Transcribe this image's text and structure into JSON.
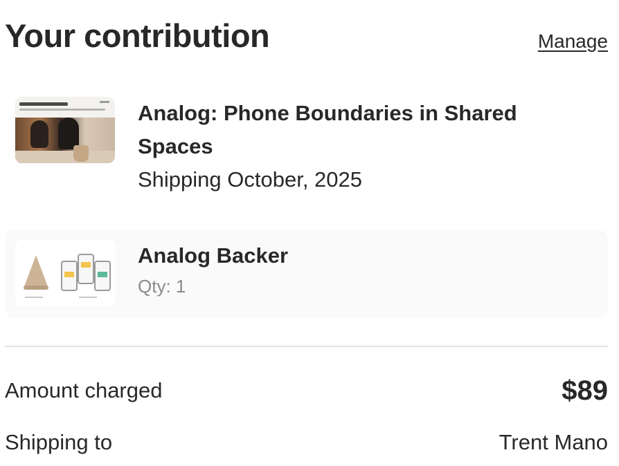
{
  "header": {
    "title": "Your contribution",
    "manage_label": "Manage"
  },
  "project": {
    "name": "Analog: Phone Boundaries in Shared Spaces",
    "shipping": "Shipping October, 2025",
    "thumbnail_icon": "project-image"
  },
  "reward": {
    "name": "Analog Backer",
    "quantity": "Qty: 1",
    "thumbnail_icon": "reward-image"
  },
  "summary": {
    "amount_label": "Amount charged",
    "amount_value": "$89",
    "shipping_label": "Shipping to",
    "shipping_value": "Trent Mano"
  },
  "colors": {
    "text": "#282828",
    "muted": "#8a8a8a",
    "card_bg": "#fafafa",
    "divider": "#e1e1e1"
  }
}
